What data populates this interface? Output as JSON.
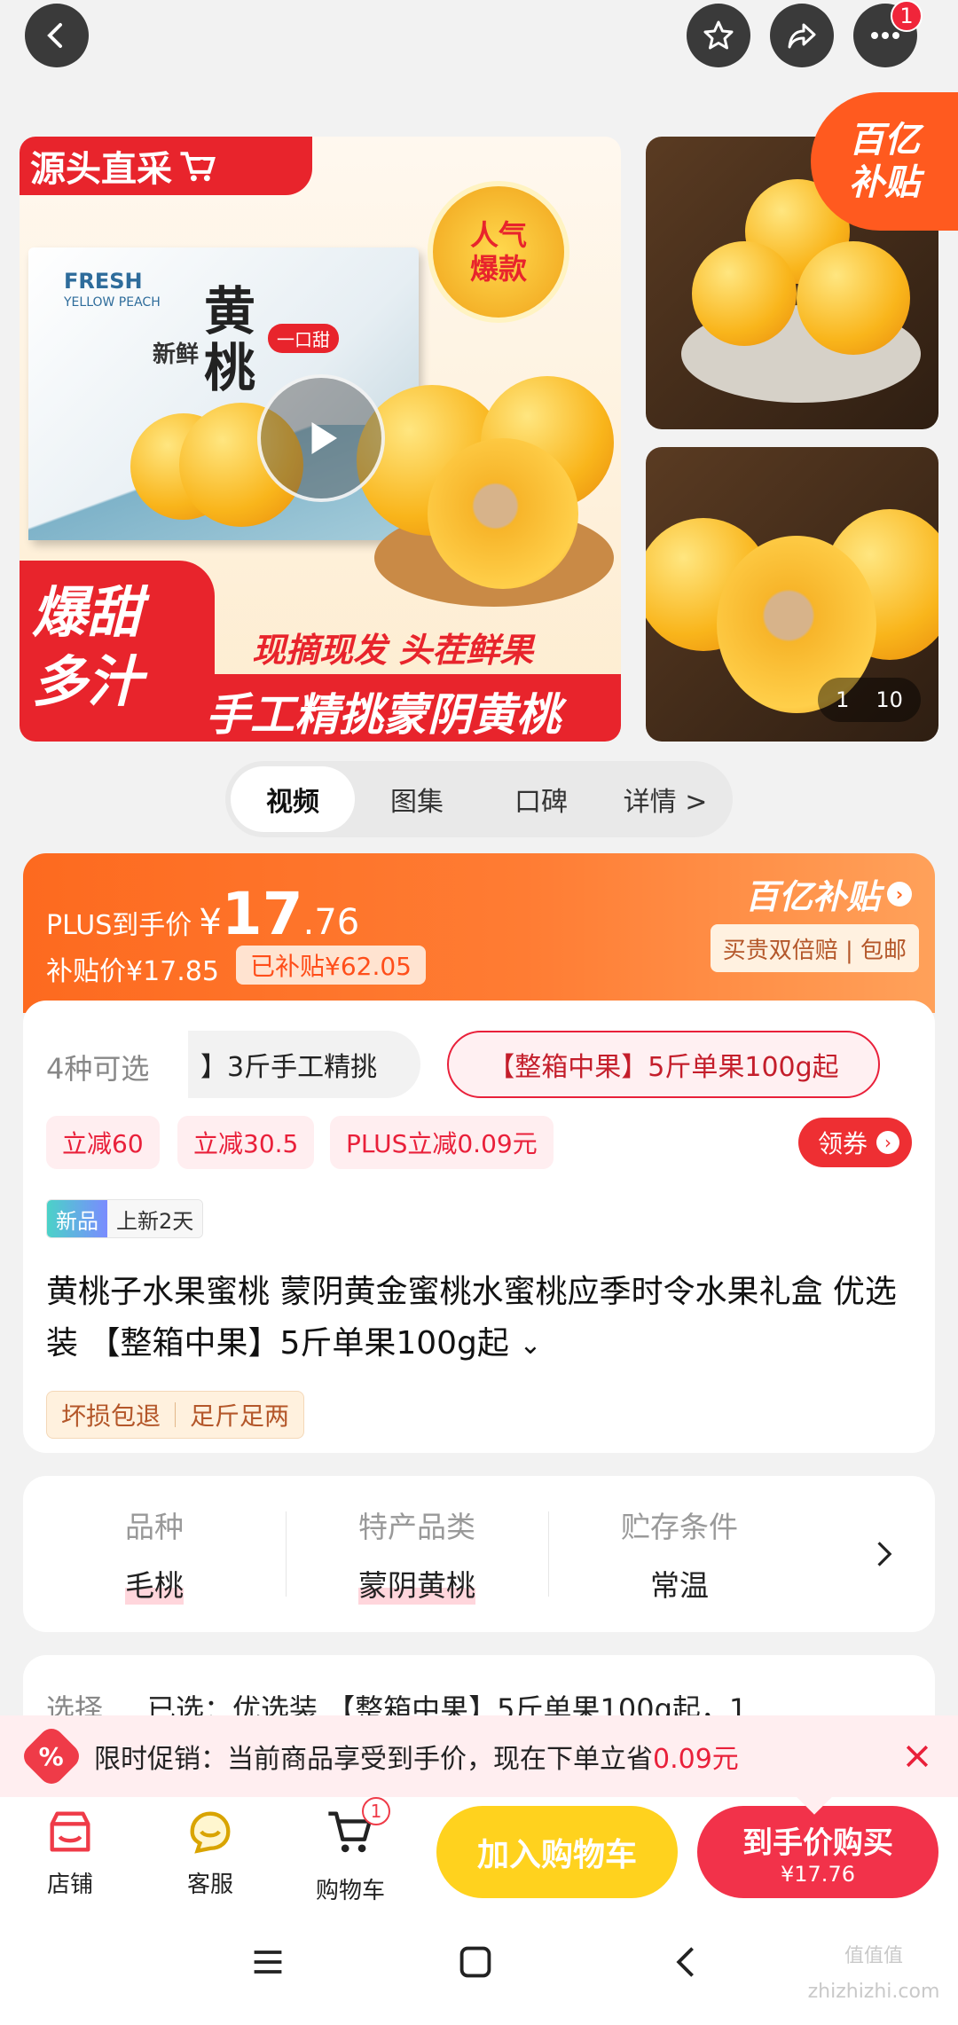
{
  "topbar": {
    "more_badge": "1"
  },
  "gallery": {
    "main_banner": "源头直采",
    "box_text_1": "FRESH",
    "box_text_2": "YELLOW PEACH",
    "box_title_small": "新鲜",
    "box_title_big": "黄桃",
    "box_tag": "一口甜",
    "seal_line1": "人气",
    "seal_line2": "爆款",
    "bottom_red_1": "爆甜",
    "bottom_red_2": "多汁",
    "slogan_1": "现摘现发 头茬鲜果",
    "slogan_2": "手工精挑蒙阴黄桃",
    "subsidy_tag_1": "百亿",
    "subsidy_tag_2": "补贴",
    "counter_current": "1",
    "counter_total": "10"
  },
  "tabs": [
    {
      "label": "视频"
    },
    {
      "label": "图集"
    },
    {
      "label": "口碑"
    },
    {
      "label": "详情 >"
    }
  ],
  "price": {
    "plus_label": "PLUS到手价",
    "currency": "¥",
    "int": "17",
    "dec": ".76",
    "subsidy_price": "补贴价¥17.85",
    "subsidized": "已补贴¥62.05",
    "program": "百亿补贴",
    "guarantee": "买贵双倍赔 | 包邮"
  },
  "specs": {
    "count": "4种可选",
    "option1": "】3斤手工精挑",
    "option2": "【整箱中果】5斤单果100g起"
  },
  "coupons": [
    "立减60",
    "立减30.5",
    "PLUS立减0.09元"
  ],
  "coupon_button": "领券",
  "new_tag": "新品",
  "new_text": "上新2天",
  "title": "黄桃子水果蜜桃 蒙阴黄金蜜桃水蜜桃应季时令水果礼盒 优选装 【整箱中果】5斤单果100g起",
  "services": [
    "坏损包退",
    "足斤足两"
  ],
  "attributes": [
    {
      "label": "品种",
      "value": "毛桃"
    },
    {
      "label": "特产品类",
      "value": "蒙阴黄桃"
    },
    {
      "label": "贮存条件",
      "value": "常温"
    }
  ],
  "selection": {
    "label": "选择",
    "value": "已选：优选装 【整箱中果】5斤单果100g起，1"
  },
  "promo": {
    "text": "限时促销：当前商品享受到手价，现在下单立省",
    "amount": "0.09元"
  },
  "bottom_nav": [
    {
      "label": "店铺"
    },
    {
      "label": "客服"
    },
    {
      "label": "购物车",
      "badge": "1"
    }
  ],
  "add_cart": "加入购物车",
  "buy": {
    "label": "到手价购买",
    "price": "¥17.76"
  },
  "watermark": "值值值 zhizhizhi.com"
}
